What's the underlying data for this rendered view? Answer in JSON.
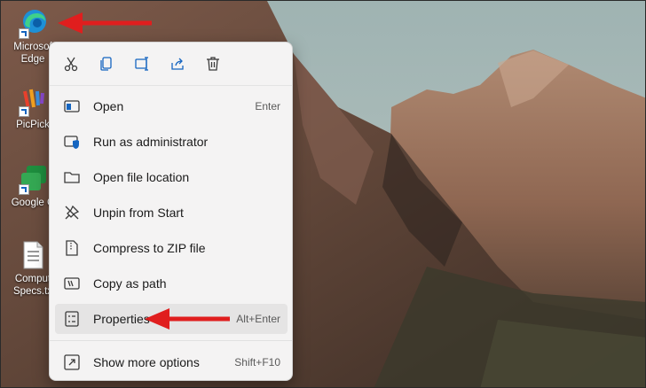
{
  "desktop": {
    "icons": [
      {
        "label_line1": "Microsof",
        "label_line2": "Edge",
        "icon": "edge-icon"
      },
      {
        "label_line1": "PicPick",
        "icon": "picpick-icon"
      },
      {
        "label_line1": "Google C",
        "icon": "google-chrome-icon"
      },
      {
        "label_line1": "Comput",
        "label_line2": "Specs.tx",
        "icon": "text-file-icon"
      }
    ]
  },
  "context_menu": {
    "toolbar": [
      "cut-icon",
      "copy-icon",
      "rename-icon",
      "share-icon",
      "delete-icon"
    ],
    "items": [
      {
        "label": "Open",
        "shortcut": "Enter",
        "icon": "app-window-icon"
      },
      {
        "label": "Run as administrator",
        "shortcut": "",
        "icon": "shield-icon"
      },
      {
        "label": "Open file location",
        "shortcut": "",
        "icon": "folder-icon"
      },
      {
        "label": "Unpin from Start",
        "shortcut": "",
        "icon": "unpin-icon"
      },
      {
        "label": "Compress to ZIP file",
        "shortcut": "",
        "icon": "zip-icon"
      },
      {
        "label": "Copy as path",
        "shortcut": "",
        "icon": "path-icon"
      },
      {
        "label": "Properties",
        "shortcut": "Alt+Enter",
        "icon": "properties-icon"
      },
      {
        "label": "Show more options",
        "shortcut": "Shift+F10",
        "icon": "more-options-icon"
      }
    ]
  },
  "colors": {
    "annotation_arrow": "#e01e1e",
    "accent": "#1565c0"
  }
}
